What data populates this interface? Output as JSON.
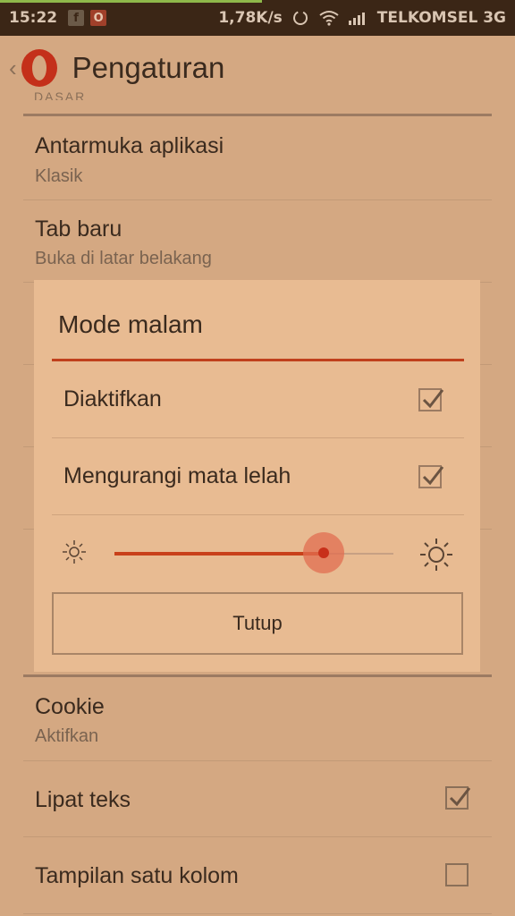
{
  "status_bar": {
    "time": "15:22",
    "notification_icons": [
      "facebook-icon",
      "opera-icon"
    ],
    "network_speed": "1,78K/s",
    "carrier": "TELKOMSEL 3G"
  },
  "app_bar": {
    "title": "Pengaturan"
  },
  "settings": {
    "section_cut_label": "DASAR",
    "items": [
      {
        "title": "Antarmuka aplikasi",
        "subtitle": "Klasik"
      },
      {
        "title": "Tab baru",
        "subtitle": "Buka di latar belakang"
      },
      {
        "title": "Cookie",
        "subtitle": "Aktifkan"
      },
      {
        "title": "Lipat teks",
        "checked": true
      },
      {
        "title": "Tampilan satu kolom",
        "checked": false
      }
    ]
  },
  "dialog": {
    "title": "Mode malam",
    "options": [
      {
        "label": "Diaktifkan",
        "checked": true
      },
      {
        "label": "Mengurangi mata lelah",
        "checked": true
      }
    ],
    "brightness_level": 0.75,
    "close_label": "Tutup"
  },
  "colors": {
    "accent": "#c8401a",
    "background": "#d4a882",
    "dialog_background": "#e8bb92",
    "status_bar": "#3b2616"
  }
}
